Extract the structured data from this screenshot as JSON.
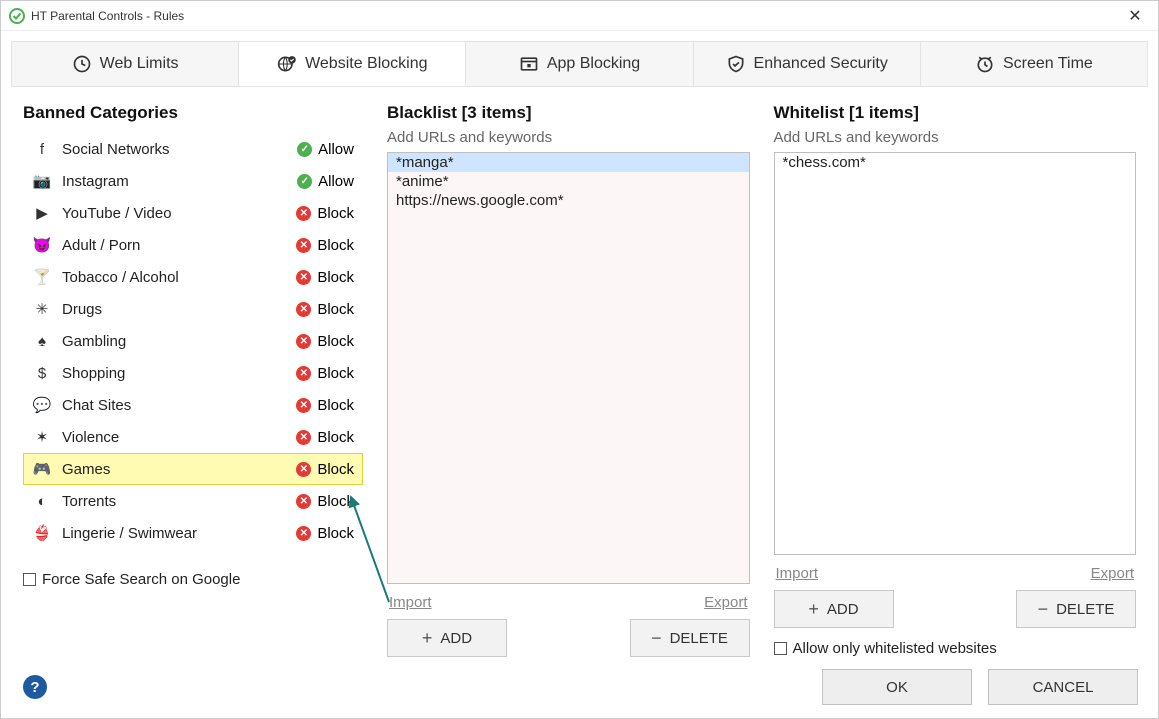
{
  "window": {
    "title": "HT Parental Controls - Rules"
  },
  "tabs": [
    {
      "label": "Web Limits"
    },
    {
      "label": "Website Blocking"
    },
    {
      "label": "App Blocking"
    },
    {
      "label": "Enhanced Security"
    },
    {
      "label": "Screen Time"
    }
  ],
  "active_tab": 1,
  "headings": {
    "categories": "Banned Categories",
    "blacklist": "Blacklist [3 items]",
    "whitelist": "Whitelist [1 items]",
    "subhint": "Add URLs and keywords"
  },
  "categories": [
    {
      "icon": "f",
      "label": "Social Networks",
      "status": "Allow"
    },
    {
      "icon": "📷",
      "label": "Instagram",
      "status": "Allow"
    },
    {
      "icon": "▶",
      "label": "YouTube / Video",
      "status": "Block"
    },
    {
      "icon": "😈",
      "label": "Adult / Porn",
      "status": "Block"
    },
    {
      "icon": "🍸",
      "label": "Tobacco / Alcohol",
      "status": "Block"
    },
    {
      "icon": "✳",
      "label": "Drugs",
      "status": "Block"
    },
    {
      "icon": "♠",
      "label": "Gambling",
      "status": "Block"
    },
    {
      "icon": "$",
      "label": "Shopping",
      "status": "Block"
    },
    {
      "icon": "💬",
      "label": "Chat Sites",
      "status": "Block"
    },
    {
      "icon": "✶",
      "label": "Violence",
      "status": "Block"
    },
    {
      "icon": "🎮",
      "label": "Games",
      "status": "Block",
      "highlight": true
    },
    {
      "icon": "◐",
      "label": "Torrents",
      "status": "Block"
    },
    {
      "icon": "👙",
      "label": "Lingerie / Swimwear",
      "status": "Block"
    }
  ],
  "blacklist": {
    "items": [
      "*manga*",
      "*anime*",
      "https://news.google.com*"
    ],
    "selected": 0
  },
  "whitelist": {
    "items": [
      "*chess.com*"
    ],
    "selected": -1
  },
  "links": {
    "import": "Import",
    "export": "Export"
  },
  "buttons": {
    "add": "ADD",
    "delete": "DELETE",
    "ok": "OK",
    "cancel": "CANCEL"
  },
  "checkboxes": {
    "safe_search": "Force Safe Search on Google",
    "only_whitelist": "Allow only whitelisted websites"
  }
}
